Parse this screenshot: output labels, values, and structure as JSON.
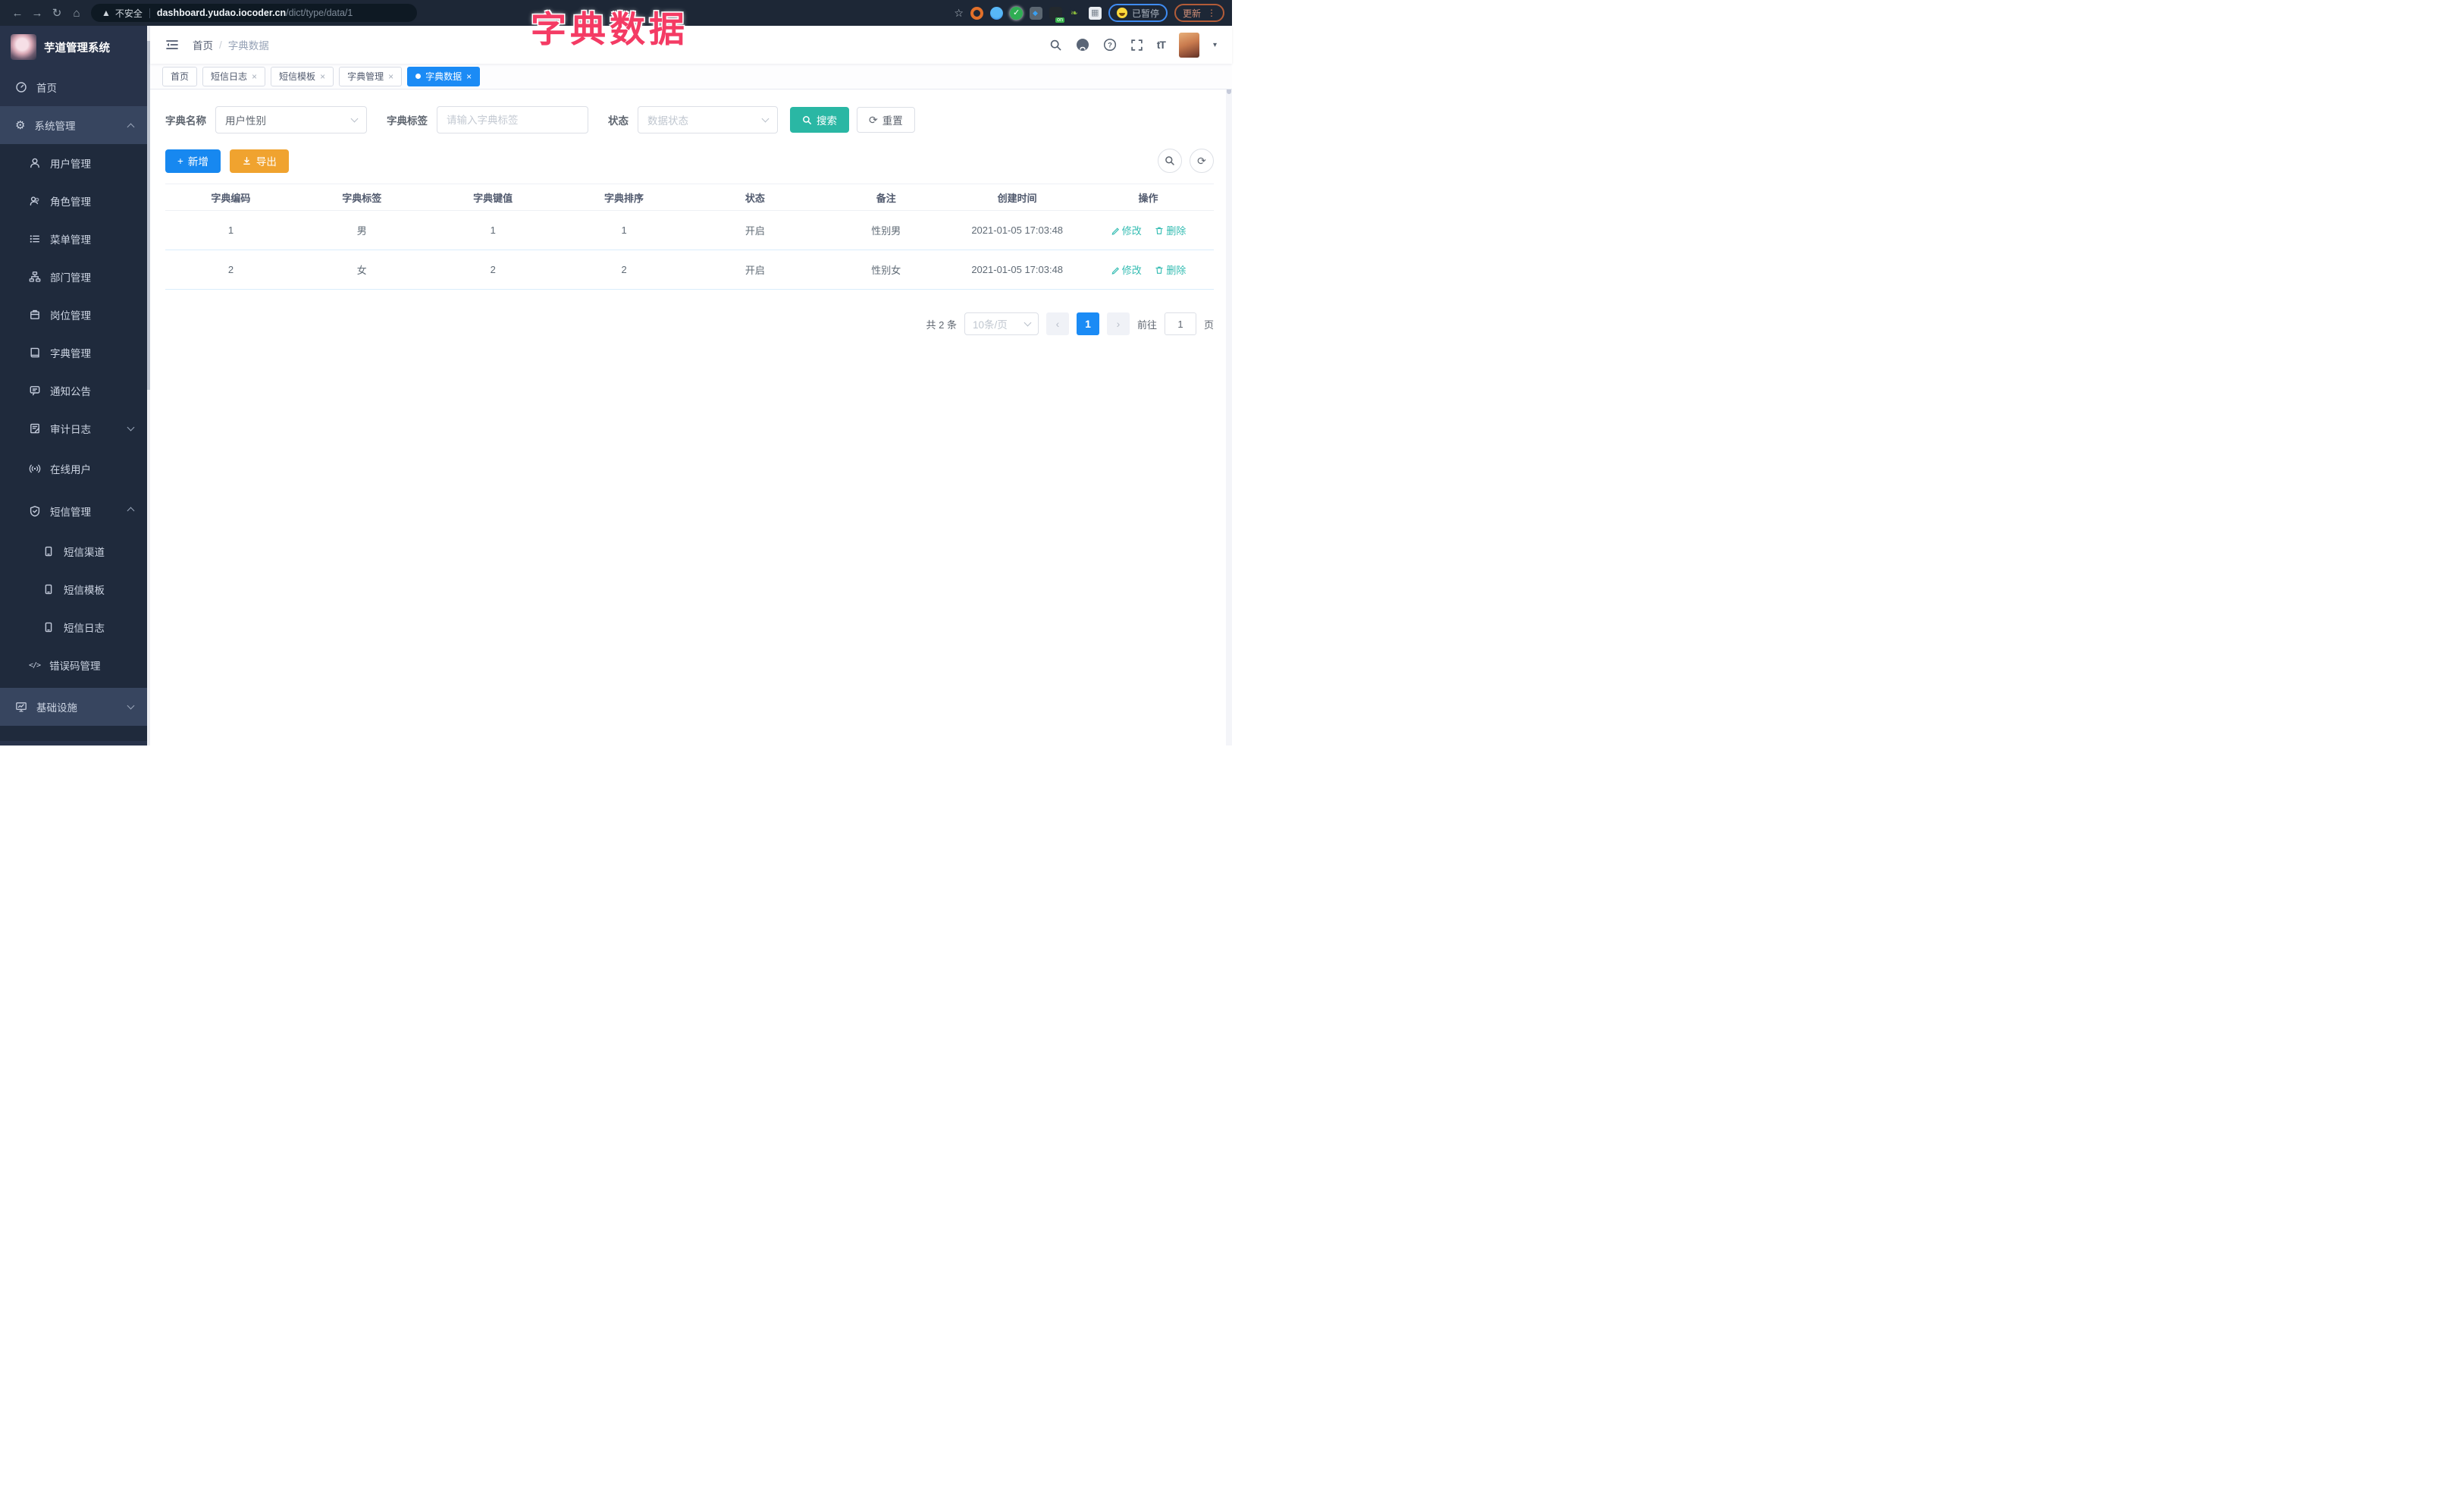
{
  "browser": {
    "security_label": "不安全",
    "url_host": "dashboard.yudao.iocoder.cn",
    "url_path": "/dict/type/data/1",
    "paused_badge": "已暂停",
    "update_button": "更新"
  },
  "overlay_title": "字典数据",
  "sidebar": {
    "app_title": "芋道管理系统",
    "items": [
      {
        "label": "首页",
        "icon": "dashboard-icon",
        "level": 1
      },
      {
        "label": "系统管理",
        "icon": "gear-icon",
        "level": 1,
        "expanded": true
      },
      {
        "label": "用户管理",
        "icon": "user-icon",
        "level": 2
      },
      {
        "label": "角色管理",
        "icon": "roles-icon",
        "level": 2
      },
      {
        "label": "菜单管理",
        "icon": "menu-list-icon",
        "level": 2
      },
      {
        "label": "部门管理",
        "icon": "org-tree-icon",
        "level": 2
      },
      {
        "label": "岗位管理",
        "icon": "post-badge-icon",
        "level": 2
      },
      {
        "label": "字典管理",
        "icon": "dictionary-icon",
        "level": 2
      },
      {
        "label": "通知公告",
        "icon": "announcement-icon",
        "level": 2
      },
      {
        "label": "审计日志",
        "icon": "audit-log-icon",
        "level": 2,
        "collapsed": true
      },
      {
        "label": "在线用户",
        "icon": "online-user-icon",
        "level": 2
      },
      {
        "label": "短信管理",
        "icon": "sms-shield-icon",
        "level": 2,
        "expanded": true
      },
      {
        "label": "短信渠道",
        "icon": "sms-channel-icon",
        "level": 3
      },
      {
        "label": "短信模板",
        "icon": "sms-template-icon",
        "level": 3
      },
      {
        "label": "短信日志",
        "icon": "sms-log-icon",
        "level": 3
      },
      {
        "label": "错误码管理",
        "icon": "error-code-icon",
        "level": 2
      },
      {
        "label": "基础设施",
        "icon": "infrastructure-icon",
        "level": 1,
        "collapsed": true
      }
    ]
  },
  "header": {
    "breadcrumb_home": "首页",
    "breadcrumb_sep": "/",
    "breadcrumb_current": "字典数据"
  },
  "tabs": [
    {
      "label": "首页",
      "closable": false,
      "active": false
    },
    {
      "label": "短信日志",
      "closable": true,
      "active": false
    },
    {
      "label": "短信模板",
      "closable": true,
      "active": false
    },
    {
      "label": "字典管理",
      "closable": true,
      "active": false
    },
    {
      "label": "字典数据",
      "closable": true,
      "active": true
    }
  ],
  "filters": {
    "dict_name_label": "字典名称",
    "dict_name_value": "用户性别",
    "dict_label_label": "字典标签",
    "dict_label_placeholder": "请输入字典标签",
    "status_label": "状态",
    "status_placeholder": "数据状态",
    "search_button": "搜索",
    "reset_button": "重置"
  },
  "toolbar": {
    "add_button": "新增",
    "export_button": "导出"
  },
  "table": {
    "columns": [
      "字典编码",
      "字典标签",
      "字典键值",
      "字典排序",
      "状态",
      "备注",
      "创建时间",
      "操作"
    ],
    "rows": [
      {
        "code": "1",
        "label": "男",
        "value": "1",
        "sort": "1",
        "status": "开启",
        "remark": "性别男",
        "created": "2021-01-05 17:03:48"
      },
      {
        "code": "2",
        "label": "女",
        "value": "2",
        "sort": "2",
        "status": "开启",
        "remark": "性别女",
        "created": "2021-01-05 17:03:48"
      }
    ],
    "edit_label": "修改",
    "delete_label": "删除"
  },
  "pagination": {
    "total_text": "共 2 条",
    "page_size": "10条/页",
    "current_page": "1",
    "goto_label": "前往",
    "goto_value": "1",
    "page_unit": "页"
  },
  "colors": {
    "accent_blue": "#1b8bf5",
    "teal": "#2ab7a4",
    "amber": "#f0a32f",
    "overlay_pink": "#f43b64",
    "sidebar_bg": "#28334a"
  }
}
